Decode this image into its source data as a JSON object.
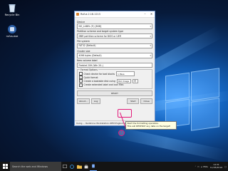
{
  "desktop": {
    "icons": [
      {
        "name": "recycle-bin",
        "label": "Recycle Bin"
      },
      {
        "name": "rufus",
        "label": "rufus.exe"
      }
    ]
  },
  "window": {
    "title": "Rufus 2.18.1213",
    "device_label": "Device",
    "device_value": "NO_LABEL (F:) [8GB]",
    "partition_label": "Partition scheme and target system type",
    "partition_value": "MBR partition scheme for BIOS or UEFI",
    "filesystem_label": "File system",
    "filesystem_value": "FAT32 (Default)",
    "cluster_label": "Cluster size",
    "cluster_value": "4096 bytes (Default)",
    "volume_label": "New volume label",
    "volume_value": "Firebird 20H (Win 20..)",
    "format_options_title": "Format Options",
    "bad_blocks_label": "Check device for bad blocks",
    "bad_blocks_passes": "1 Pass",
    "quick_format_label": "Quick format",
    "bootable_label": "Create a bootable disk using",
    "bootable_type": "ISO Image",
    "extended_label": "Create extended label and icon files",
    "progress_text": "READY",
    "about_label": "About...",
    "log_label": "Log",
    "start_label": "Start",
    "close_label": "Close",
    "status_text": "Using ... Redstone Workstation.OEM.English.iso"
  },
  "tooltip": {
    "line1": "Start the formatting operation.",
    "line2": "This will DESTROY any data on the target!"
  },
  "annotation": {
    "number": "1"
  },
  "taskbar": {
    "search_placeholder": "Search the web and Windows",
    "time": "14:31",
    "date": "11/05/2016",
    "language": "ENG"
  }
}
